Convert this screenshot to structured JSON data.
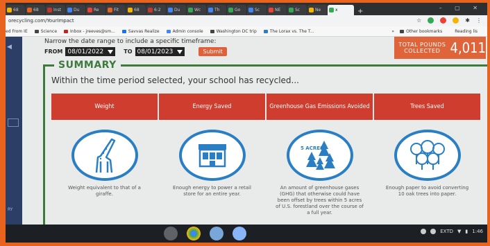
{
  "browser": {
    "tabs": [
      "68",
      "68",
      "Inst",
      "Du",
      "Re",
      "Fit",
      "68",
      "6:2",
      "Du",
      "Wc",
      "Th",
      "Go",
      "Sc",
      "NE",
      "Sc",
      "Ne"
    ],
    "active_tab": "x",
    "new_tab": "+",
    "url": "orecycling.com/YourImpact",
    "bookmarks": [
      "ed From IE",
      "Science",
      "Inbox - jreeves@sm...",
      "Savvas Realize",
      "Admin console",
      "Washington DC trip",
      "The Lorax vs. The T...",
      "»",
      "Other bookmarks",
      "Reading lis"
    ]
  },
  "filter": {
    "instruction": "Narrow the date range to include a specific timeframe:",
    "from_label": "FROM",
    "from_value": "08/01/2022",
    "to_label": "TO",
    "to_value": "08/01/2023",
    "submit_label": "Submit"
  },
  "totals": {
    "label_line1": "TOTAL POUNDS",
    "label_line2": "COLLECTED",
    "value": "4,011"
  },
  "summary": {
    "title": "SUMMARY",
    "subtitle": "Within the time period selected, your school has recycled...",
    "cards": [
      {
        "heading": "Weight",
        "icon": "giraffe-icon",
        "description": "Weight equivalent to that of a giraffe."
      },
      {
        "heading": "Energy Saved",
        "icon": "store-icon",
        "description": "Enough energy to power a retail store for an entire year."
      },
      {
        "heading": "Greenhouse Gas Emissions Avoided",
        "icon": "forest-icon",
        "icon_text": "5 ACRES",
        "description": "An amount of greenhouse gases (GHG) that otherwise could have been offset by trees within 5 acres of U.S. forestland over the course of a full year."
      },
      {
        "heading": "Trees Saved",
        "icon": "trees-icon",
        "description": "Enough paper to avoid converting 10 oak trees into paper."
      }
    ]
  },
  "leftnav": {
    "label": "RY"
  },
  "shelf": {
    "ime": "EXTD",
    "time": "1:46"
  },
  "colors": {
    "accent_red": "#cf3d2e",
    "summary_green": "#3e7a3c",
    "circle_blue": "#2a7fc4",
    "totals_orange": "#e0643a"
  }
}
